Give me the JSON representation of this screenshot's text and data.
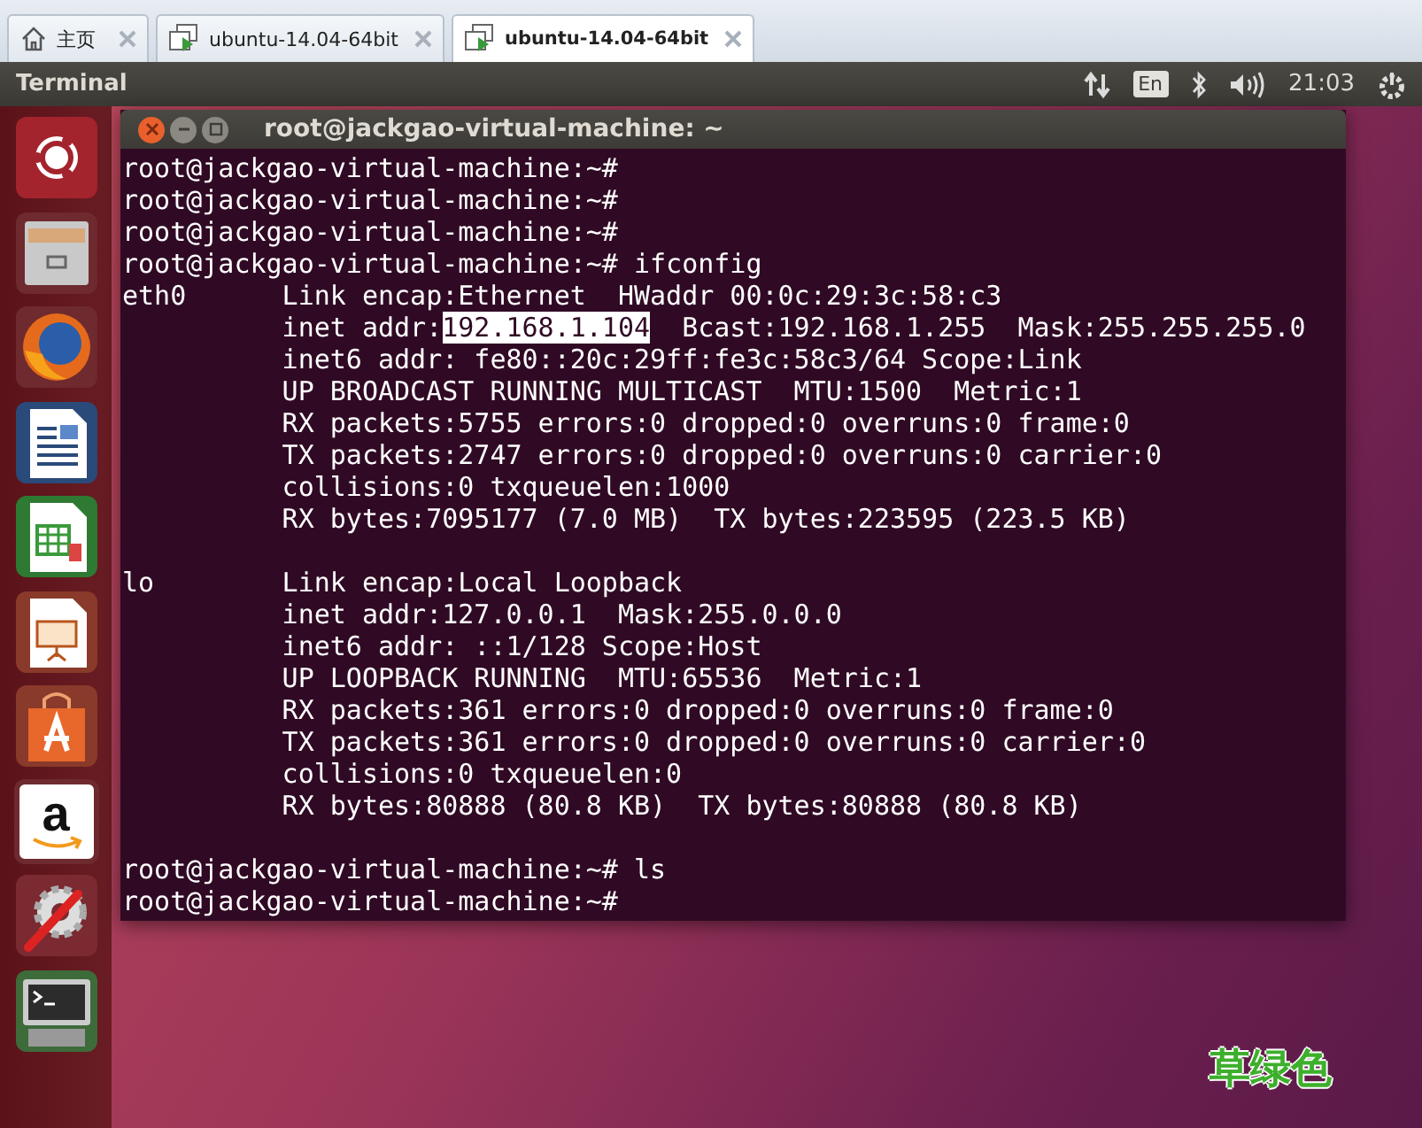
{
  "browser_tabs": [
    {
      "label": "主页",
      "kind": "home",
      "selected": false
    },
    {
      "label": "ubuntu-14.04-64bit",
      "kind": "vm",
      "selected": false
    },
    {
      "label": "ubuntu-14.04-64bit",
      "kind": "vm",
      "selected": true
    }
  ],
  "top_panel": {
    "app_title": "Terminal",
    "keyboard_layout": "En",
    "clock": "21:03"
  },
  "launcher": [
    {
      "kind": "ubuntu"
    },
    {
      "kind": "files"
    },
    {
      "kind": "browser"
    },
    {
      "kind": "writer"
    },
    {
      "kind": "calc"
    },
    {
      "kind": "impress"
    },
    {
      "kind": "store"
    },
    {
      "kind": "amazon",
      "glyph": "a"
    },
    {
      "kind": "settings"
    },
    {
      "kind": "terminal"
    }
  ],
  "terminal": {
    "title": "root@jackgao-virtual-machine: ~",
    "blocks": [
      [
        {
          "kind": "text",
          "text": "root@jackgao-virtual-machine:~#"
        },
        {
          "kind": "text",
          "text": "root@jackgao-virtual-machine:~#"
        },
        {
          "kind": "text",
          "text": "root@jackgao-virtual-machine:~#"
        },
        {
          "kind": "text",
          "text": "root@jackgao-virtual-machine:~# ifconfig"
        },
        {
          "kind": "text",
          "text": "eth0      Link encap:Ethernet  HWaddr 00:0c:29:3c:58:c3"
        },
        {
          "kind": "selection",
          "before": "          inet addr:",
          "selected": "192.168.1.104",
          "after": "  Bcast:192.168.1.255  Mask:255.255.255.0"
        },
        {
          "kind": "text",
          "text": "          inet6 addr: fe80::20c:29ff:fe3c:58c3/64 Scope:Link"
        },
        {
          "kind": "text",
          "text": "          UP BROADCAST RUNNING MULTICAST  MTU:1500  Metric:1"
        },
        {
          "kind": "text",
          "text": "          RX packets:5755 errors:0 dropped:0 overruns:0 frame:0"
        },
        {
          "kind": "text",
          "text": "          TX packets:2747 errors:0 dropped:0 overruns:0 carrier:0"
        },
        {
          "kind": "text",
          "text": "          collisions:0 txqueuelen:1000"
        },
        {
          "kind": "text",
          "text": "          RX bytes:7095177 (7.0 MB)  TX bytes:223595 (223.5 KB)"
        }
      ],
      [
        {
          "kind": "text",
          "text": "lo        Link encap:Local Loopback"
        },
        {
          "kind": "text",
          "text": "          inet addr:127.0.0.1  Mask:255.0.0.0"
        },
        {
          "kind": "text",
          "text": "          inet6 addr: ::1/128 Scope:Host"
        },
        {
          "kind": "text",
          "text": "          UP LOOPBACK RUNNING  MTU:65536  Metric:1"
        },
        {
          "kind": "text",
          "text": "          RX packets:361 errors:0 dropped:0 overruns:0 frame:0"
        },
        {
          "kind": "text",
          "text": "          TX packets:361 errors:0 dropped:0 overruns:0 carrier:0"
        },
        {
          "kind": "text",
          "text": "          collisions:0 txqueuelen:0"
        },
        {
          "kind": "text",
          "text": "          RX bytes:80888 (80.8 KB)  TX bytes:80888 (80.8 KB)"
        }
      ],
      [
        {
          "kind": "text",
          "text": "root@jackgao-virtual-machine:~# ls"
        },
        {
          "kind": "text",
          "text": "root@jackgao-virtual-machine:~#"
        }
      ]
    ]
  },
  "annotation": "草绿色"
}
